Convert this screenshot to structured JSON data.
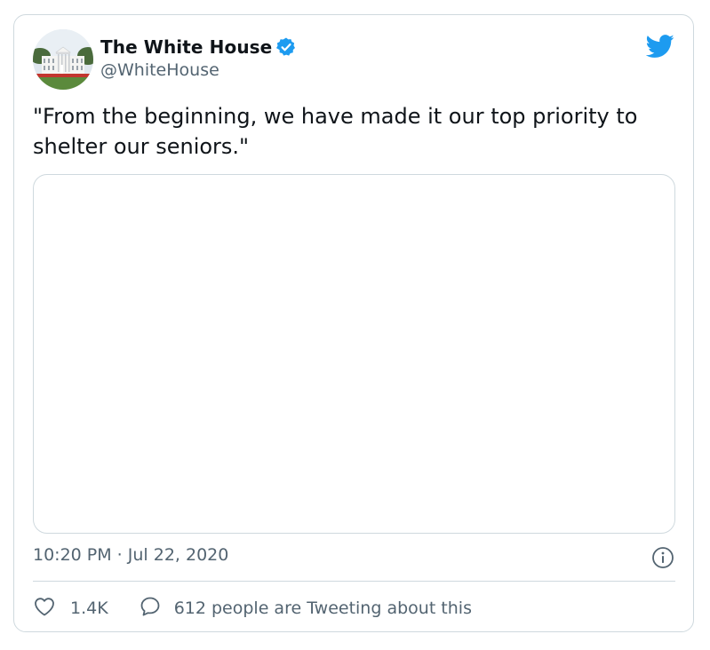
{
  "tweet": {
    "display_name": "The White House",
    "handle": "@WhiteHouse",
    "text": "\"From the beginning, we have made it our top priority to shelter our seniors.\"",
    "timestamp": "10:20 PM · Jul 22, 2020",
    "like_count": "1.4K",
    "conversation_text": "612 people are Tweeting about this"
  },
  "icons": {
    "verified": "verified-badge-icon",
    "brand": "twitter-bird-icon",
    "info": "info-icon",
    "like": "heart-icon",
    "reply": "speech-bubble-icon"
  },
  "colors": {
    "brand_blue": "#1d9bf0",
    "text_primary": "#0f1419",
    "text_secondary": "#536471",
    "border": "#cfd9de"
  }
}
